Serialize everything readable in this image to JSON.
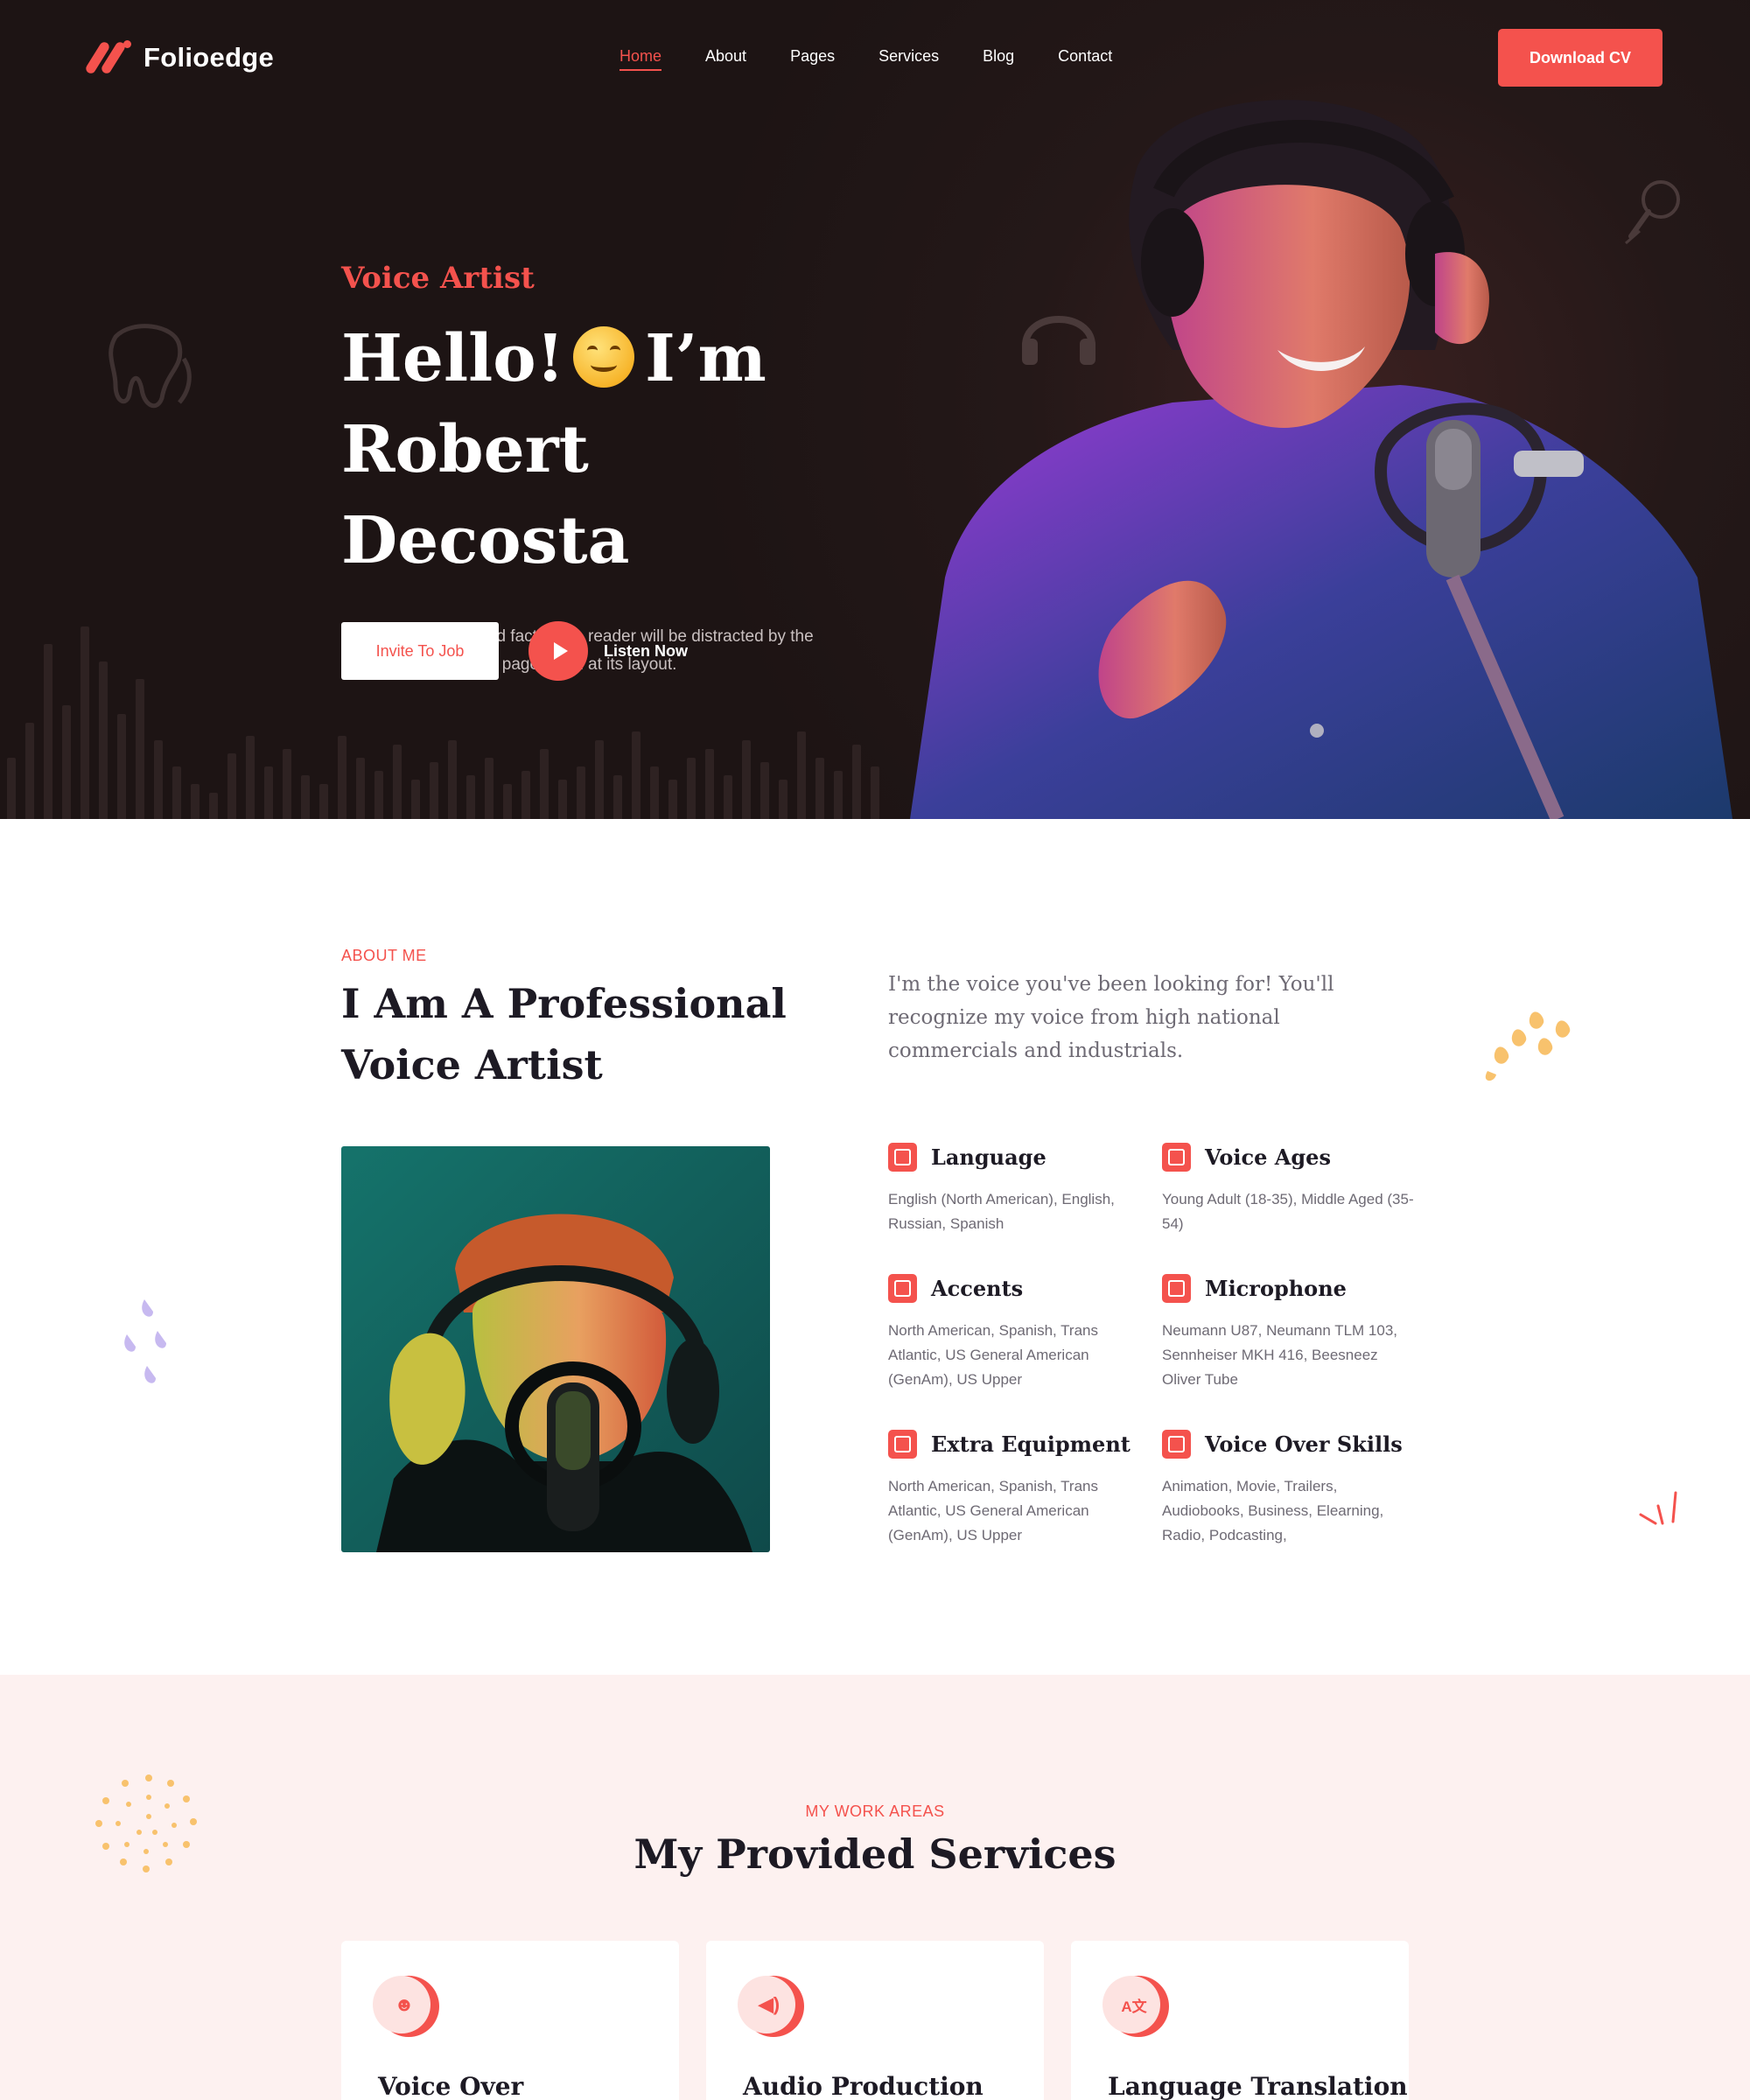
{
  "brand": {
    "name": "Folioedge",
    "accent": "#f4524d",
    "hero_bg": "#1d1414"
  },
  "nav": {
    "items": [
      {
        "label": "Home",
        "active": true
      },
      {
        "label": "About"
      },
      {
        "label": "Pages"
      },
      {
        "label": "Services"
      },
      {
        "label": "Blog"
      },
      {
        "label": "Contact"
      }
    ],
    "cta": "Download CV"
  },
  "hero": {
    "eyebrow": "Voice Artist",
    "title_line1_a": "Hello!",
    "title_line1_b": "I’m",
    "title_line2": "Robert Decosta",
    "description": "It is a long established fact that a reader will be distracted by the readable content of a page when at its layout.",
    "invite_label": "Invite To Job",
    "listen_label": "Listen Now"
  },
  "about": {
    "eyebrow": "ABOUT ME",
    "title": "I Am A Professional Voice Artist",
    "intro": "I'm the voice you've been looking for! You'll recognize my voice from high national commercials and industrials.",
    "features": [
      {
        "title": "Language",
        "desc": "English (North American), English, Russian, Spanish"
      },
      {
        "title": "Voice Ages",
        "desc": "Young Adult (18-35), Middle Aged (35-54)"
      },
      {
        "title": "Accents",
        "desc": "North American, Spanish, Trans Atlantic, US General American (GenAm), US Upper"
      },
      {
        "title": "Microphone",
        "desc": "Neumann U87, Neumann TLM 103, Sennheiser MKH 416, Beesneez Oliver Tube"
      },
      {
        "title": "Extra Equipment",
        "desc": "North American, Spanish, Trans Atlantic, US General American (GenAm), US Upper"
      },
      {
        "title": "Voice Over Skills",
        "desc": "Animation, Movie, Trailers, Audiobooks, Business, Elearning, Radio, Podcasting,"
      }
    ]
  },
  "services": {
    "eyebrow": "MY WORK AREAS",
    "title": "My Provided Services",
    "cards": [
      {
        "title": "Voice Over",
        "icon": "voice-over-icon"
      },
      {
        "title": "Audio Production",
        "icon": "speaker-icon"
      },
      {
        "title": "Language Translation",
        "icon": "translate-icon"
      }
    ]
  }
}
